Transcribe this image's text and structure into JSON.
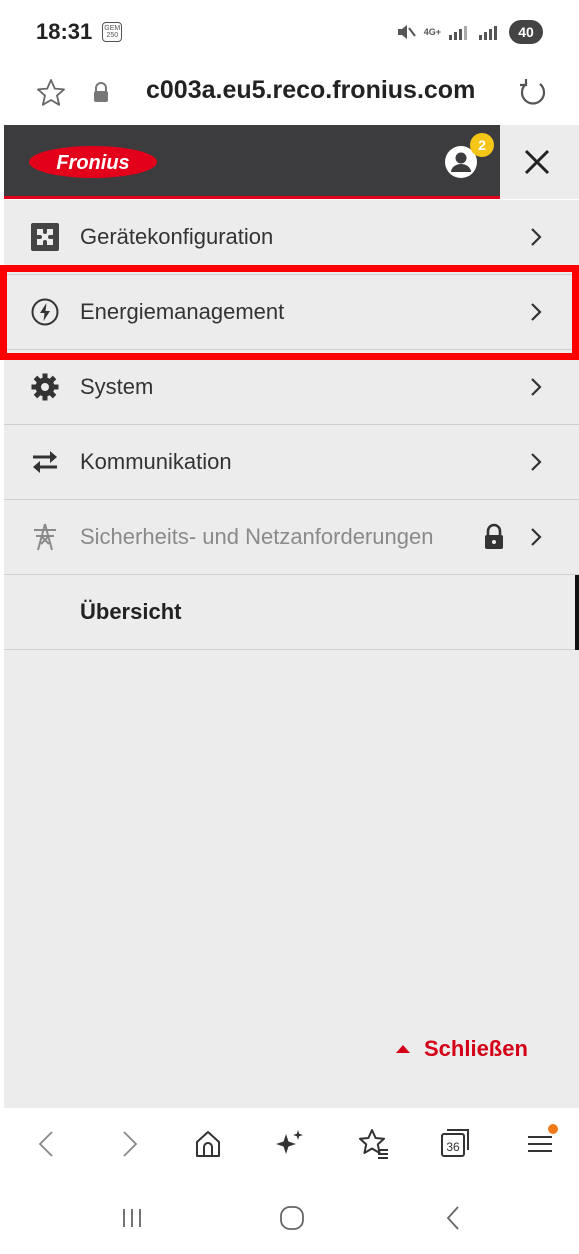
{
  "status_bar": {
    "time": "18:31",
    "notification_icon_text": "GEM 250",
    "network": "4G+",
    "battery": "40"
  },
  "address_bar": {
    "url": "c003a.eu5.reco.fronius.com"
  },
  "header": {
    "logo_text": "Fronius",
    "notification_count": "2"
  },
  "menu": {
    "items": [
      {
        "label": "Gerätekonfiguration",
        "icon": "puzzle-icon",
        "enabled": true
      },
      {
        "label": "Energiemanagement",
        "icon": "energy-icon",
        "enabled": true,
        "highlighted": true
      },
      {
        "label": "System",
        "icon": "gear-icon",
        "enabled": true
      },
      {
        "label": "Kommunikation",
        "icon": "transfer-arrows-icon",
        "enabled": true
      },
      {
        "label": "Sicherheits- und Netzanforderungen",
        "icon": "power-pylon-icon",
        "enabled": false,
        "locked": true
      },
      {
        "label": "Übersicht",
        "enabled": true,
        "active": true
      }
    ],
    "close_label": "Schließen"
  },
  "browser_toolbar": {
    "tab_count": "36"
  },
  "colors": {
    "brand_red": "#e2001a",
    "header_bg": "#3c3c3e",
    "menu_bg": "#ececec",
    "highlight": "#ff0000",
    "badge": "#f5c518"
  }
}
